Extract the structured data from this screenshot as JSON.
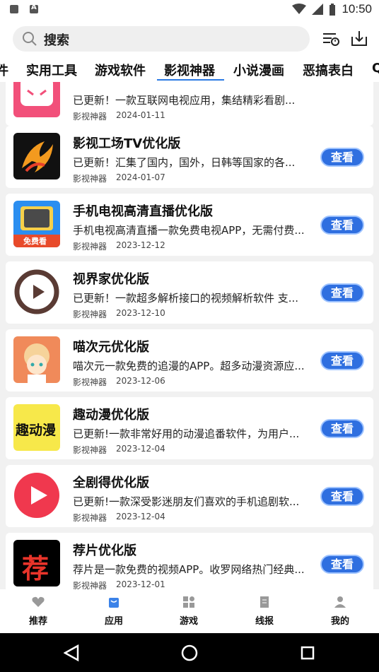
{
  "status": {
    "time": "10:50"
  },
  "search": {
    "placeholder": "搜索"
  },
  "tabs": [
    {
      "label": "件"
    },
    {
      "label": "实用工具"
    },
    {
      "label": "游戏软件"
    },
    {
      "label": "影视神器"
    },
    {
      "label": "小说漫画"
    },
    {
      "label": "恶搞表白"
    },
    {
      "label": "Q"
    }
  ],
  "active_tab": "影视神器",
  "apps": [
    {
      "title": "",
      "desc": "已更新！一款互联网电视应用，集结精彩看剧...",
      "category": "影视神器",
      "date": "2024-01-11",
      "button": "查看",
      "icon": "pink-tv-face-icon"
    },
    {
      "title": "影视工场TV优化版",
      "desc": "已更新！汇集了国内，国外，日韩等国家的各...",
      "category": "影视神器",
      "date": "2024-01-07",
      "button": "查看",
      "icon": "phoenix-icon"
    },
    {
      "title": "手机电视高清直播优化版",
      "desc": "手机电视高清直播一款免费电视APP，无需付费...",
      "category": "影视神器",
      "date": "2023-12-12",
      "button": "查看",
      "icon": "retro-tv-icon",
      "badge": "免费看"
    },
    {
      "title": "视界家优化版",
      "desc": "已更新！一款超多解析接口的视频解析软件 支...",
      "category": "影视神器",
      "date": "2023-12-10",
      "button": "查看",
      "icon": "play-circle-icon"
    },
    {
      "title": "喵次元优化版",
      "desc": "喵次元一款免费的追漫的APP。超多动漫资源应...",
      "category": "影视神器",
      "date": "2023-12-06",
      "button": "查看",
      "icon": "anime-girl-icon"
    },
    {
      "title": "趣动漫优化版",
      "desc": "已更新!一款非常好用的动漫追番软件，为用户...",
      "category": "影视神器",
      "date": "2023-12-04",
      "button": "查看",
      "icon": "qudongman-logo-icon",
      "logo_text": "趣动漫"
    },
    {
      "title": "全剧得优化版",
      "desc": "已更新!一款深受影迷朋友们喜欢的手机追剧软...",
      "category": "影视神器",
      "date": "2023-12-04",
      "button": "查看",
      "icon": "red-play-icon"
    },
    {
      "title": "荐片优化版",
      "desc": "荐片是一款免费的视频APP。收罗网络热门经典...",
      "category": "影视神器",
      "date": "2023-12-01",
      "button": "查看",
      "icon": "jianpian-logo-icon",
      "logo_text": "荐"
    }
  ],
  "bottom_nav": [
    {
      "label": "推荐",
      "icon": "heart-icon"
    },
    {
      "label": "应用",
      "icon": "bag-icon"
    },
    {
      "label": "游戏",
      "icon": "grid-icon"
    },
    {
      "label": "线报",
      "icon": "document-icon"
    },
    {
      "label": "我的",
      "icon": "person-icon"
    }
  ],
  "colors": {
    "accent": "#2a7ae4",
    "button": "#2f6fe0"
  }
}
